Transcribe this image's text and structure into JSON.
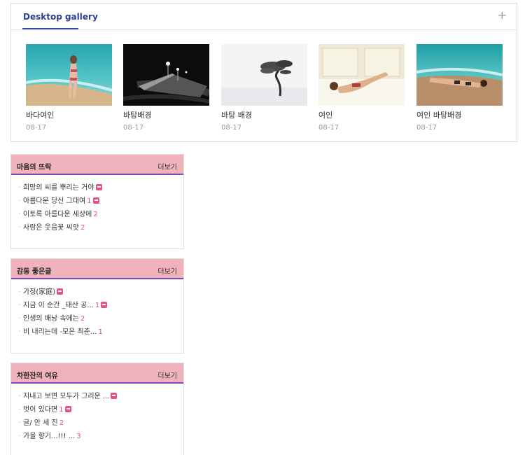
{
  "gallery": {
    "title": "Desktop gallery",
    "plus": "+",
    "items": [
      {
        "title": "바다여인",
        "date": "08-17"
      },
      {
        "title": "바탕배경",
        "date": "08-17"
      },
      {
        "title": "바탕 배경",
        "date": "08-17"
      },
      {
        "title": "여인",
        "date": "08-17"
      },
      {
        "title": "여인 바탕배경",
        "date": "08-17"
      }
    ]
  },
  "boxes": [
    {
      "title": "마음의 뜨락",
      "more": "더보기",
      "items": [
        {
          "text": "희망의 씨를 뿌리는 거야",
          "count": "",
          "badge": true
        },
        {
          "text": "아름다운 당신 그대여",
          "count": "1",
          "badge": true
        },
        {
          "text": "이토록 아름다운 세상에",
          "count": "2",
          "badge": false
        },
        {
          "text": "사랑은 웃음꽃 씨앗",
          "count": "2",
          "badge": false
        }
      ]
    },
    {
      "title": "감동 좋은글",
      "more": "더보기",
      "items": [
        {
          "text": "가정(家庭)",
          "count": "",
          "badge": true
        },
        {
          "text": "지금 이 순간 _태산 공...",
          "count": "1",
          "badge": true
        },
        {
          "text": "인생의 배낭 속에는",
          "count": "2",
          "badge": false
        },
        {
          "text": "비 내리는데 -모은 최춘...",
          "count": "1",
          "badge": false
        }
      ]
    },
    {
      "title": "차한잔의 여유",
      "more": "더보기",
      "items": [
        {
          "text": "지내고 보면 모두가 그리운 ...",
          "count": "",
          "badge": true
        },
        {
          "text": "벗이 있다면",
          "count": "1",
          "badge": true
        },
        {
          "text": "글/ 안 세 진",
          "count": "2",
          "badge": false
        },
        {
          "text": "가을 향기...!!! ...",
          "count": "3",
          "badge": false
        }
      ]
    }
  ]
}
